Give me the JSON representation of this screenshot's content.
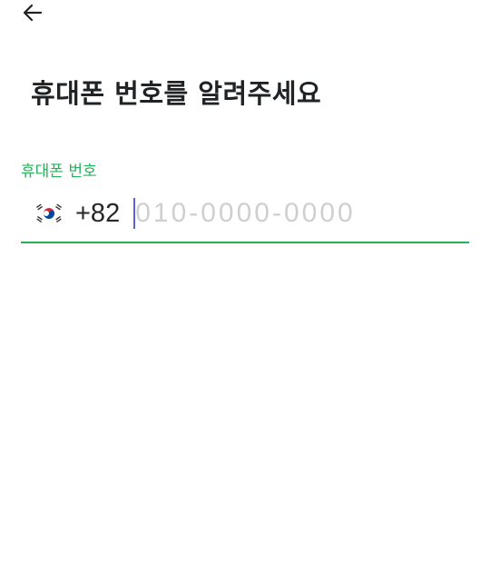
{
  "header": {
    "back_icon": "arrow-left-icon"
  },
  "main": {
    "title": "휴대폰 번호를 알려주세요",
    "phone_field": {
      "label": "휴대폰 번호",
      "country_flag_icon": "south-korea-flag-icon",
      "country_code": "+82",
      "value": "",
      "placeholder": "010-0000-0000"
    }
  },
  "colors": {
    "accent": "#27b05a",
    "title": "#1f2326",
    "placeholder": "#cfcfcf",
    "caret": "#5b62d6"
  }
}
